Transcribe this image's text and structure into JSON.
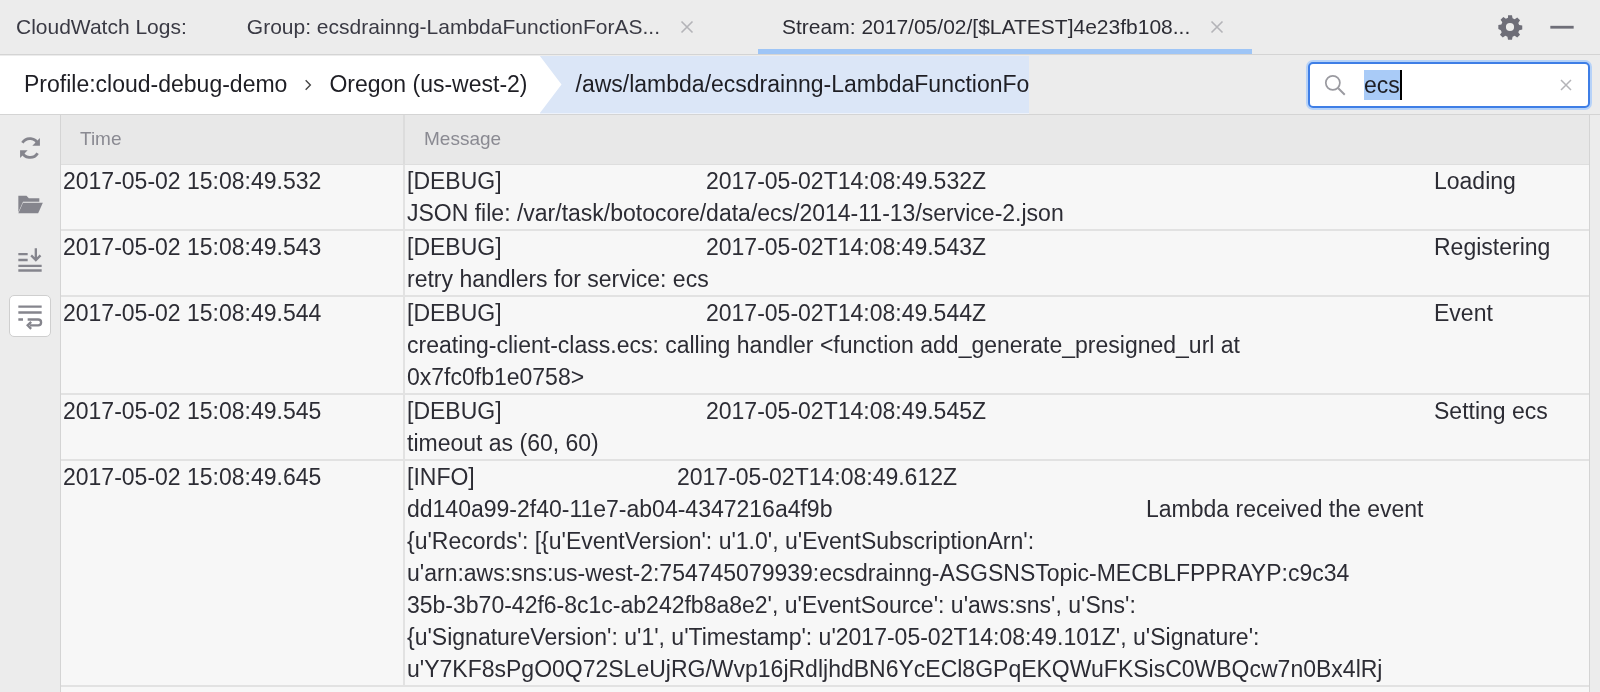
{
  "header_label": "CloudWatch Logs:",
  "tabs": [
    {
      "label": "Group: ecsdrainng-LambdaFunctionForAS...",
      "selected": false
    },
    {
      "label": "Stream: 2017/05/02/[$LATEST]4e23fb108...",
      "selected": true
    }
  ],
  "breadcrumb": [
    {
      "label": "Profile:cloud-debug-demo",
      "selected": false
    },
    {
      "label": "Oregon (us-west-2)",
      "selected": false
    },
    {
      "label": "/aws/lambda/ecsdrainng-LambdaFunctionFo",
      "selected": true
    }
  ],
  "search": {
    "value": "ecs"
  },
  "toolbar": [
    {
      "kind": "refresh",
      "on": false
    },
    {
      "kind": "open",
      "on": false
    },
    {
      "kind": "scroll_end",
      "on": false
    },
    {
      "kind": "wrap",
      "on": true
    }
  ],
  "table": {
    "columns": [
      "Time",
      "Message"
    ],
    "rows": [
      {
        "kind": "debug",
        "time": "2017-05-02 15:08:49.532",
        "lines": [
          [
            "[DEBUG]",
            "2017-05-02T14:08:49.532Z",
            "Loading"
          ],
          [
            "JSON file: /var/task/botocore/data/ecs/2014-11-13/service-2.json"
          ]
        ]
      },
      {
        "kind": "debug",
        "time": "2017-05-02 15:08:49.543",
        "lines": [
          [
            "[DEBUG]",
            "2017-05-02T14:08:49.543Z",
            "Registering"
          ],
          [
            "retry handlers for service: ecs"
          ]
        ]
      },
      {
        "kind": "debug",
        "time": "2017-05-02 15:08:49.544",
        "lines": [
          [
            "[DEBUG]",
            "2017-05-02T14:08:49.544Z",
            "Event"
          ],
          [
            "creating-client-class.ecs: calling handler <function add_generate_presigned_url at"
          ],
          [
            "0x7fc0fb1e0758>"
          ]
        ]
      },
      {
        "kind": "debug",
        "time": "2017-05-02 15:08:49.545",
        "lines": [
          [
            "[DEBUG]",
            "2017-05-02T14:08:49.545Z",
            "Setting ecs"
          ],
          [
            "timeout as (60, 60)"
          ]
        ]
      },
      {
        "kind": "info",
        "time": "2017-05-02 15:08:49.645",
        "lines": [
          [
            "[INFO]",
            "2017-05-02T14:08:49.612Z"
          ],
          [
            "dd140a99-2f40-11e7-ab04-4347216a4f9b",
            "Lambda received the event"
          ],
          [
            "{u'Records': [{u'EventVersion': u'1.0', u'EventSubscriptionArn':"
          ],
          [
            "u'arn:aws:sns:us-west-2:754745079939:ecsdrainng-ASGSNSTopic-MECBLFPPRAYP:c9c34"
          ],
          [
            "35b-3b70-42f6-8c1c-ab242fb8a8e2', u'EventSource': u'aws:sns', u'Sns':"
          ],
          [
            "{u'SignatureVersion': u'1', u'Timestamp': u'2017-05-02T14:08:49.101Z', u'Signature':"
          ],
          [
            "u'Y7KF8sPgO0Q72SLeUjRG/Wvp16jRdljhdBN6YcECl8GPqEKQWuFKSisC0WBQcw7n0Bx4lRj"
          ]
        ]
      }
    ]
  }
}
